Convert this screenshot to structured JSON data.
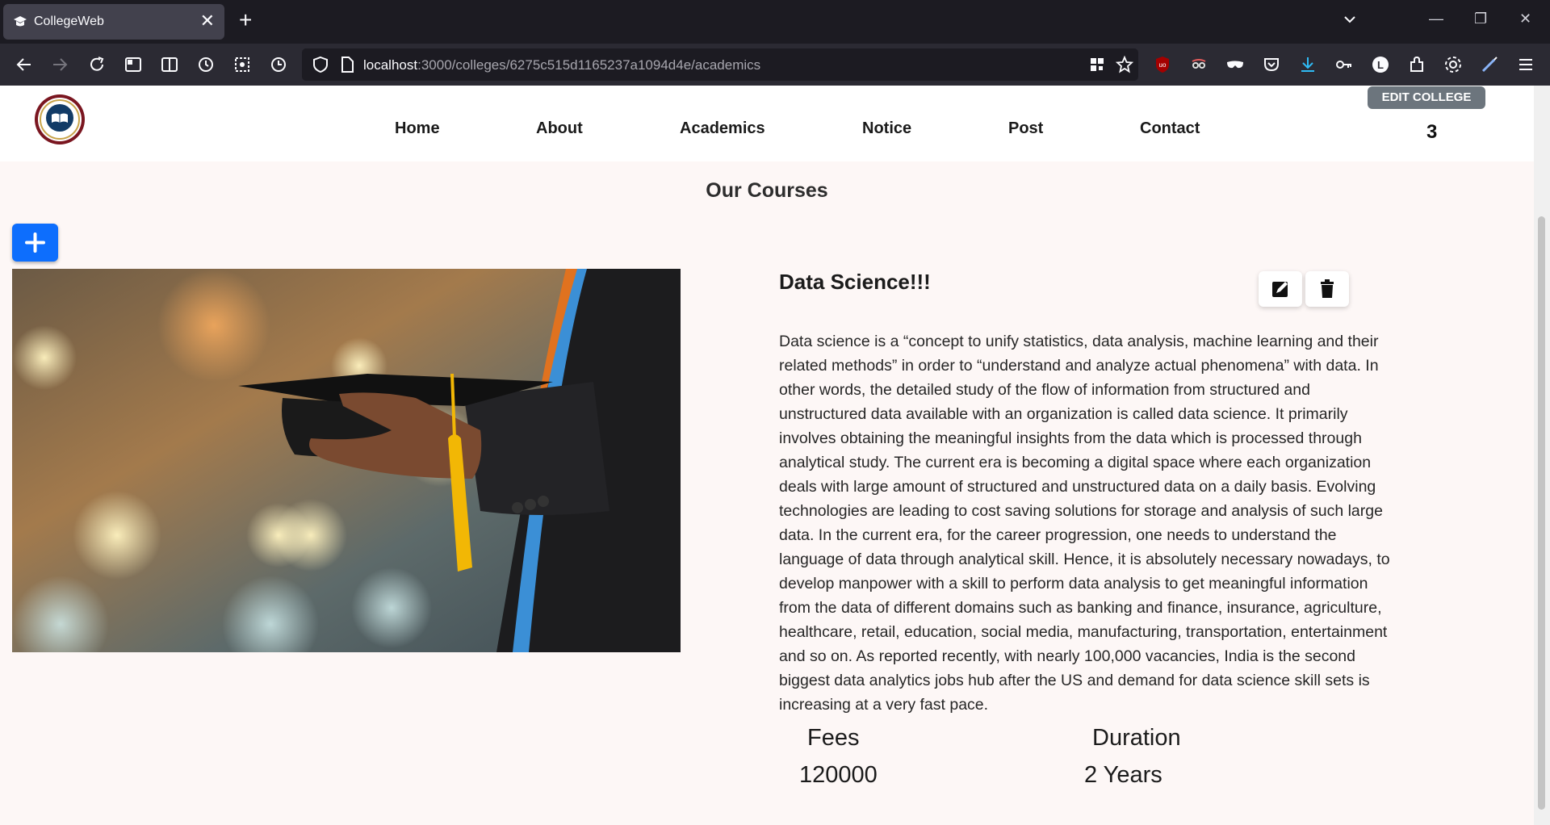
{
  "browser": {
    "tab_title": "CollegeWeb",
    "tab_close": "✕",
    "new_tab": "+",
    "url_host": "localhost",
    "url_path": ":3000/colleges/6275c515d1165237a1094d4e/academics",
    "window_controls": {
      "minimize": "—",
      "restore": "❐",
      "close": "✕"
    },
    "extension_icons": [
      "ublock-icon",
      "privacy-badger-icon",
      "mask-icon",
      "pocket-icon",
      "download-icon",
      "key-icon",
      "l-extension-icon",
      "puzzle-icon",
      "settings-icon",
      "pen-icon",
      "menu-icon"
    ]
  },
  "header": {
    "nav": [
      "Home",
      "About",
      "Academics",
      "Notice",
      "Post",
      "Contact"
    ],
    "edit_button": "EDIT COLLEGE",
    "counter": "3"
  },
  "main": {
    "section_title": "Our Courses",
    "add_button": "+",
    "course": {
      "title": "Data Science!!!",
      "description": "Data science is a “concept to unify statistics, data analysis, machine learning and their related methods” in order to “understand and analyze actual phenomena” with data. In other words, the detailed study of the flow of information from structured and unstructured data available with an organization is called data science. It primarily involves obtaining the meaningful insights from the data which is processed through analytical study. The current era is becoming a digital space where each organization deals with large amount of structured and unstructured data on a daily basis. Evolving technologies are leading to cost saving solutions for storage and analysis of such large data. In the current era, for the career progression, one needs to understand the language of data through analytical skill. Hence, it is absolutely necessary nowadays, to develop manpower with a skill to perform data analysis to get meaningful information from the data of different domains such as banking and finance, insurance, agriculture, healthcare, retail, education, social media, manufacturing, transportation, entertainment and so on. As reported recently, with nearly 100,000 vacancies, India is the second biggest data analytics jobs hub after the US and demand for data science skill sets is increasing at a very fast pace.",
      "fees_label": "Fees",
      "fees_value": "120000",
      "duration_label": "Duration",
      "duration_value": "2 Years"
    }
  },
  "colors": {
    "accent": "#0d6efd",
    "page_bg": "#fdf7f6",
    "edit_btn": "#6c757d"
  }
}
